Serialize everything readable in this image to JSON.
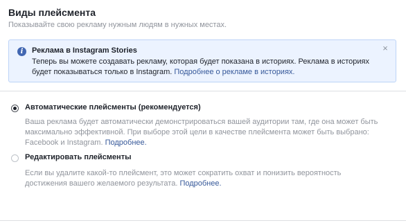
{
  "section": {
    "title": "Виды плейсмента",
    "subtitle": "Показывайте свою рекламу нужным людям в нужных местах."
  },
  "info_box": {
    "icon": "info-icon",
    "title": "Реклама в Instagram Stories",
    "text": "Теперь вы можете создавать рекламу, которая будет показана в историях. Реклама в историях будет показываться только в Instagram. ",
    "link": "Подробнее о рекламе в историях.",
    "close": "×"
  },
  "options": [
    {
      "label": "Автоматические плейсменты (рекомендуется)",
      "selected": true,
      "description": "Ваша реклама будет автоматически демонстрироваться вашей аудитории там, где она может быть максимально эффективной. При выборе этой цели в качестве плейсмента может быть выбрано: Facebook и Instagram. ",
      "link": "Подробнее."
    },
    {
      "label": "Редактировать плейсменты",
      "selected": false,
      "description": "Если вы удалите какой-то плейсмент, это может сократить охват и понизить вероятность достижения вашего желаемого результата. ",
      "link": "Подробнее."
    }
  ]
}
